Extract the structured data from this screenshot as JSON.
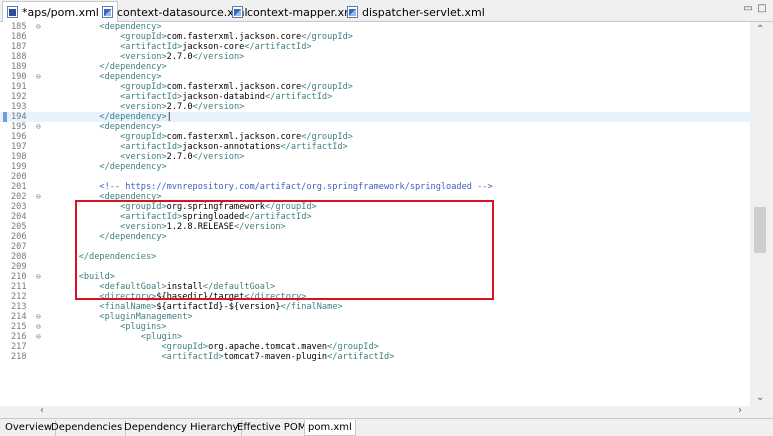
{
  "tabs": [
    {
      "label": "*aps/pom.xml",
      "icon": "maven-pom-icon",
      "active": true
    },
    {
      "label": "context-datasource.xml",
      "icon": "xml-file-icon"
    },
    {
      "label": "context-mapper.xml",
      "icon": "xml-file-icon"
    },
    {
      "label": "dispatcher-servlet.xml",
      "icon": "xml-file-icon"
    }
  ],
  "window_controls": {
    "minimize": "▭",
    "maximize": "□"
  },
  "editor": {
    "current_line": 194,
    "lines": [
      {
        "n": "185",
        "fold": "⊖",
        "indent": "        ",
        "segs": [
          [
            "t",
            "<dependency>"
          ]
        ]
      },
      {
        "n": "186",
        "indent": "            ",
        "segs": [
          [
            "t",
            "<groupId>"
          ],
          [
            "tx",
            "com.fasterxml.jackson.core"
          ],
          [
            "t",
            "</groupId>"
          ]
        ]
      },
      {
        "n": "187",
        "indent": "            ",
        "segs": [
          [
            "t",
            "<artifactId>"
          ],
          [
            "tx",
            "jackson-core"
          ],
          [
            "t",
            "</artifactId>"
          ]
        ]
      },
      {
        "n": "188",
        "indent": "            ",
        "segs": [
          [
            "t",
            "<version>"
          ],
          [
            "tx",
            "2.7.0"
          ],
          [
            "t",
            "</version>"
          ]
        ]
      },
      {
        "n": "189",
        "indent": "        ",
        "segs": [
          [
            "t",
            "</dependency>"
          ]
        ]
      },
      {
        "n": "190",
        "fold": "⊖",
        "indent": "        ",
        "segs": [
          [
            "t",
            "<dependency>"
          ]
        ]
      },
      {
        "n": "191",
        "indent": "            ",
        "segs": [
          [
            "t",
            "<groupId>"
          ],
          [
            "tx",
            "com.fasterxml.jackson.core"
          ],
          [
            "t",
            "</groupId>"
          ]
        ]
      },
      {
        "n": "192",
        "indent": "            ",
        "segs": [
          [
            "t",
            "<artifactId>"
          ],
          [
            "tx",
            "jackson-databind"
          ],
          [
            "t",
            "</artifactId>"
          ]
        ]
      },
      {
        "n": "193",
        "indent": "            ",
        "segs": [
          [
            "t",
            "<version>"
          ],
          [
            "tx",
            "2.7.0"
          ],
          [
            "t",
            "</version>"
          ]
        ]
      },
      {
        "n": "194",
        "indent": "        ",
        "segs": [
          [
            "t",
            "</dependency>"
          ],
          [
            "tx",
            "|"
          ]
        ]
      },
      {
        "n": "195",
        "fold": "⊖",
        "indent": "        ",
        "segs": [
          [
            "t",
            "<dependency>"
          ]
        ]
      },
      {
        "n": "196",
        "indent": "            ",
        "segs": [
          [
            "t",
            "<groupId>"
          ],
          [
            "tx",
            "com.fasterxml.jackson.core"
          ],
          [
            "t",
            "</groupId>"
          ]
        ]
      },
      {
        "n": "197",
        "indent": "            ",
        "segs": [
          [
            "t",
            "<artifactId>"
          ],
          [
            "tx",
            "jackson-annotations"
          ],
          [
            "t",
            "</artifactId>"
          ]
        ]
      },
      {
        "n": "198",
        "indent": "            ",
        "segs": [
          [
            "t",
            "<version>"
          ],
          [
            "tx",
            "2.7.0"
          ],
          [
            "t",
            "</version>"
          ]
        ]
      },
      {
        "n": "199",
        "indent": "        ",
        "segs": [
          [
            "t",
            "</dependency>"
          ]
        ]
      },
      {
        "n": "200",
        "indent": "",
        "segs": []
      },
      {
        "n": "201",
        "indent": "        ",
        "segs": [
          [
            "cm",
            "<!-- https://mvnrepository.com/artifact/org.springframework/springloaded -->"
          ]
        ]
      },
      {
        "n": "202",
        "fold": "⊖",
        "indent": "        ",
        "segs": [
          [
            "t",
            "<dependency>"
          ]
        ]
      },
      {
        "n": "203",
        "indent": "            ",
        "segs": [
          [
            "t",
            "<groupId>"
          ],
          [
            "tx",
            "org.springframework"
          ],
          [
            "t",
            "</groupId>"
          ]
        ]
      },
      {
        "n": "204",
        "indent": "            ",
        "segs": [
          [
            "t",
            "<artifactId>"
          ],
          [
            "tx",
            "springloaded"
          ],
          [
            "t",
            "</artifactId>"
          ]
        ]
      },
      {
        "n": "205",
        "indent": "            ",
        "segs": [
          [
            "t",
            "<version>"
          ],
          [
            "tx",
            "1.2.8.RELEASE"
          ],
          [
            "t",
            "</version>"
          ]
        ]
      },
      {
        "n": "206",
        "indent": "        ",
        "segs": [
          [
            "t",
            "</dependency>"
          ]
        ]
      },
      {
        "n": "207",
        "indent": "",
        "segs": []
      },
      {
        "n": "208",
        "indent": "    ",
        "segs": [
          [
            "t",
            "</dependencies>"
          ]
        ]
      },
      {
        "n": "209",
        "indent": "",
        "segs": []
      },
      {
        "n": "210",
        "fold": "⊖",
        "indent": "    ",
        "segs": [
          [
            "t",
            "<build>"
          ]
        ]
      },
      {
        "n": "211",
        "indent": "        ",
        "segs": [
          [
            "t",
            "<defaultGoal>"
          ],
          [
            "tx",
            "install"
          ],
          [
            "t",
            "</defaultGoal>"
          ]
        ]
      },
      {
        "n": "212",
        "indent": "        ",
        "segs": [
          [
            "t",
            "<directory>"
          ],
          [
            "tx",
            "${basedir}/target"
          ],
          [
            "t",
            "</directory>"
          ]
        ]
      },
      {
        "n": "213",
        "indent": "        ",
        "segs": [
          [
            "t",
            "<finalName>"
          ],
          [
            "tx",
            "${artifactId}-${version}"
          ],
          [
            "t",
            "</finalName>"
          ]
        ]
      },
      {
        "n": "214",
        "fold": "⊖",
        "indent": "        ",
        "segs": [
          [
            "t",
            "<pluginManagement>"
          ]
        ]
      },
      {
        "n": "215",
        "fold": "⊖",
        "indent": "            ",
        "segs": [
          [
            "t",
            "<plugins>"
          ]
        ]
      },
      {
        "n": "216",
        "fold": "⊖",
        "indent": "                ",
        "segs": [
          [
            "t",
            "<plugin>"
          ]
        ]
      },
      {
        "n": "217",
        "indent": "                    ",
        "segs": [
          [
            "t",
            "<groupId>"
          ],
          [
            "tx",
            "org.apache.tomcat.maven"
          ],
          [
            "t",
            "</groupId>"
          ]
        ]
      },
      {
        "n": "218",
        "indent": "                    ",
        "segs": [
          [
            "t",
            "<artifactId>"
          ],
          [
            "tx",
            "tomcat7-maven-plugin"
          ],
          [
            "t",
            "</artifactId>"
          ]
        ]
      }
    ]
  },
  "bottom_tabs": [
    "Overview",
    "Dependencies",
    "Dependency Hierarchy",
    "Effective POM",
    "pom.xml"
  ],
  "active_bottom_tab": "pom.xml",
  "colors": {
    "tag": "#3f7f7f",
    "comment": "#3f5fbf",
    "highlight_border": "#d9121f",
    "current_line": "#e8f2fe"
  }
}
